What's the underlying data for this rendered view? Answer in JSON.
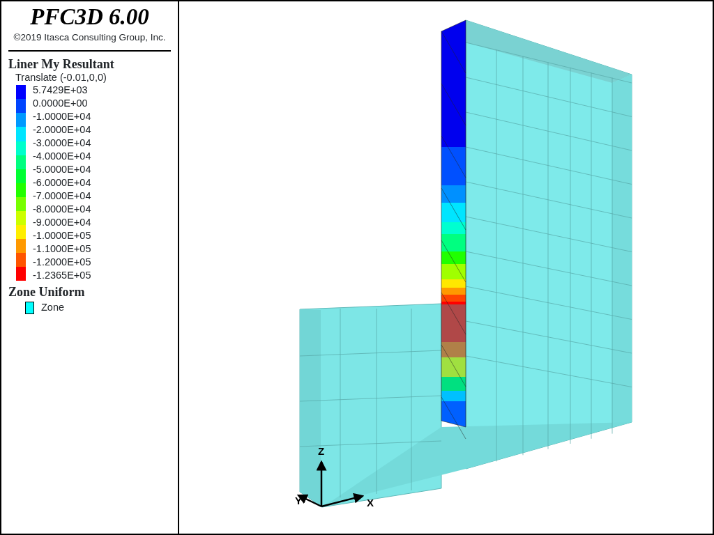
{
  "header": {
    "title": "PFC3D 6.00",
    "copyright": "©2019 Itasca Consulting Group, Inc."
  },
  "legend": {
    "title": "Liner My Resultant",
    "subtitle": "Translate (-0.01,0,0)",
    "levels": [
      "5.7429E+03",
      "0.0000E+00",
      "-1.0000E+04",
      "-2.0000E+04",
      "-3.0000E+04",
      "-4.0000E+04",
      "-5.0000E+04",
      "-6.0000E+04",
      "-7.0000E+04",
      "-8.0000E+04",
      "-9.0000E+04",
      "-1.0000E+05",
      "-1.1000E+05",
      "-1.2000E+05",
      "-1.2365E+05"
    ],
    "bands": [
      {
        "color": "#0000ff"
      },
      {
        "color": "#0044ff"
      },
      {
        "color": "#0099ff"
      },
      {
        "color": "#00e5ff"
      },
      {
        "color": "#00ffcc"
      },
      {
        "color": "#00ff80"
      },
      {
        "color": "#00ff33"
      },
      {
        "color": "#22ff00"
      },
      {
        "color": "#77ff00"
      },
      {
        "color": "#ccff00"
      },
      {
        "color": "#ffee00"
      },
      {
        "color": "#ff9900"
      },
      {
        "color": "#ff5500"
      },
      {
        "color": "#ff0000"
      }
    ]
  },
  "zone_legend": {
    "title": "Zone Uniform",
    "items": [
      {
        "label": "Zone",
        "color": "#00ffff"
      }
    ]
  },
  "view": {
    "axes": [
      {
        "label": "Z"
      },
      {
        "label": "Y"
      },
      {
        "label": "X"
      }
    ]
  }
}
